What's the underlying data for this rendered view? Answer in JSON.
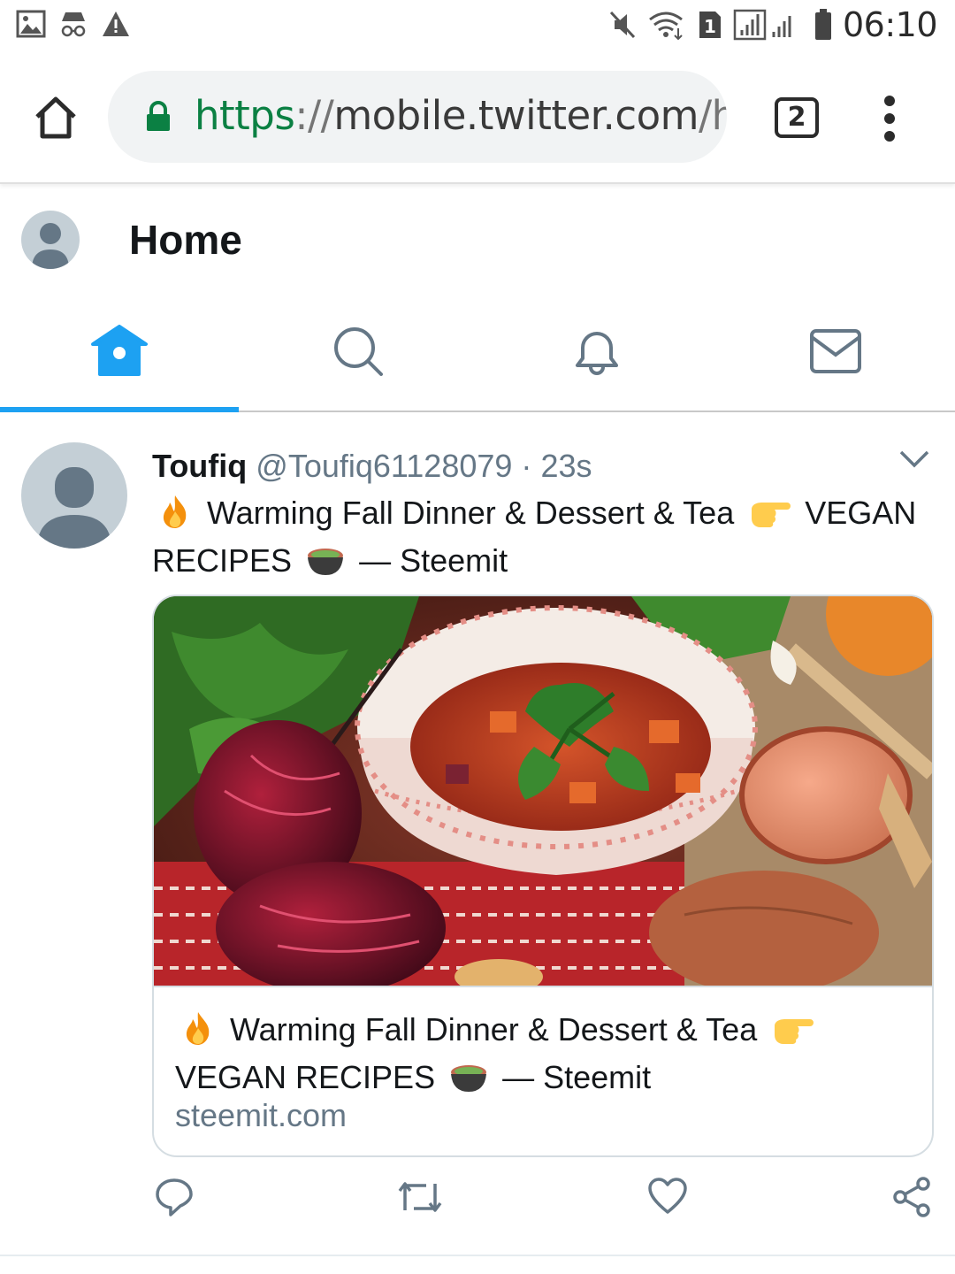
{
  "status_bar": {
    "time": "06:10",
    "sim_badge": "1",
    "icons_left": [
      "image-icon",
      "incognito-icon",
      "warning-icon"
    ],
    "icons_right": [
      "mute-icon",
      "wifi-icon",
      "sim-icon",
      "signal-icon",
      "battery-icon"
    ]
  },
  "browser": {
    "url_scheme": "https",
    "url_sep": "://",
    "url_host": "mobile.twitter.com",
    "url_path": "/h",
    "tab_count": "2"
  },
  "twitter": {
    "page_title": "Home",
    "nav_tabs": [
      "home",
      "search",
      "notifications",
      "messages"
    ],
    "accent": "#1da1f2"
  },
  "tweet": {
    "name": "Toufiq",
    "handle": "@Toufiq61128079",
    "dot": "·",
    "time": "23s",
    "text_part1": "Warming Fall Dinner &  Dessert & Tea",
    "text_part2": "VEGAN RECIPES",
    "text_part3": "— Steemit",
    "card": {
      "title_part1": "Warming Fall Dinner & Dessert & Tea",
      "title_part2": "VEGAN RECIPES",
      "title_part3": "— Steemit",
      "domain": "steemit.com"
    },
    "actions": [
      "reply",
      "retweet",
      "like",
      "share"
    ]
  }
}
